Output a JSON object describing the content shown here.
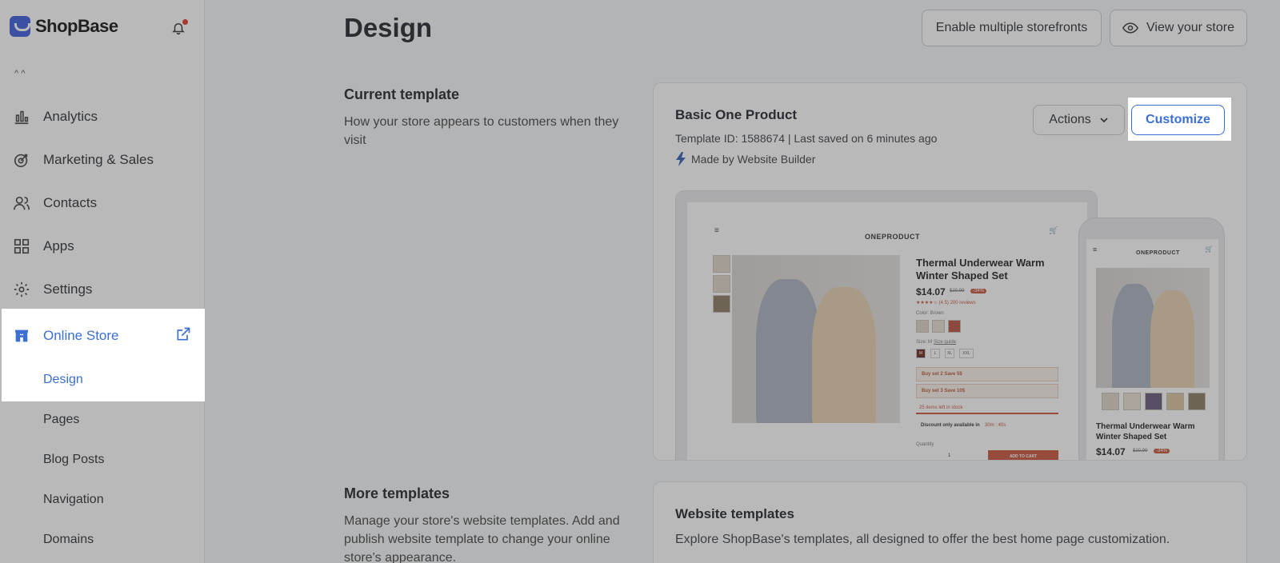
{
  "brand": {
    "name": "ShopBase"
  },
  "sidebar": {
    "scroll_hint": "^ ^",
    "items": [
      {
        "label": "Analytics",
        "icon": "bar-chart-icon"
      },
      {
        "label": "Marketing & Sales",
        "icon": "target-icon"
      },
      {
        "label": "Contacts",
        "icon": "users-icon"
      },
      {
        "label": "Apps",
        "icon": "apps-grid-icon"
      },
      {
        "label": "Settings",
        "icon": "gear-icon"
      },
      {
        "label": "Online Store",
        "icon": "store-icon"
      }
    ],
    "online_store_subitems": [
      "Design",
      "Pages",
      "Blog Posts",
      "Navigation",
      "Domains"
    ]
  },
  "header": {
    "title": "Design",
    "enable_multiple_storefronts": "Enable multiple storefronts",
    "view_your_store": "View your store"
  },
  "current_template": {
    "section_title": "Current template",
    "section_description": "How your store appears to customers when they visit",
    "name": "Basic One Product",
    "meta": "Template ID: 1588674 | Last saved on 6 minutes ago",
    "made_by": "Made by Website Builder",
    "actions_label": "Actions",
    "customize_label": "Customize",
    "preview": {
      "brand": "ONEPRODUCT",
      "product_title": "Thermal Underwear Warm Winter Shaped Set",
      "price": "$14.07",
      "compare_price": "$20.99",
      "discount": "-34%",
      "rating": "★★★★☆ (4.5) 200 reviews",
      "color_label": "Color: Brown",
      "size_label": "Size: M",
      "size_guide": "Size guide",
      "sizes": [
        "M",
        "L",
        "XL",
        "XXL"
      ],
      "bundle_1": "Buy set 2 Save 5$",
      "bundle_2": "Buy set 3 Save 10$",
      "stock": "25 items left in stock",
      "discount_notice": "Discount only available in",
      "timer": "30m : 40s",
      "quantity_label": "Quantity",
      "quantity": "1",
      "add_to_cart": "ADD TO CART"
    }
  },
  "more_templates": {
    "section_title": "More templates",
    "section_description": "Manage your store's website templates. Add and publish website template to change your online store's appearance."
  },
  "website_templates": {
    "title": "Website templates",
    "description": "Explore ShopBase's templates, all designed to offer the best home page customization."
  },
  "colors": {
    "accent": "#3b6fd1",
    "brand": "#3b5bdb",
    "notification": "#e5342a",
    "cta": "#c8533a"
  }
}
